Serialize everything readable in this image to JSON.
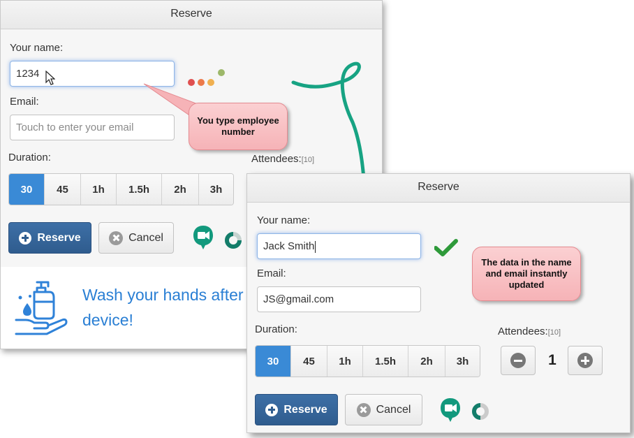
{
  "panel_back": {
    "title": "Reserve",
    "name_label": "Your name:",
    "name_value": "1234",
    "email_label": "Email:",
    "email_placeholder": "Touch to enter your email",
    "duration_label": "Duration:",
    "durations": [
      "30",
      "45",
      "1h",
      "1.5h",
      "2h",
      "3h"
    ],
    "attendees_label": "Attendees:",
    "attendees_max": "[10]",
    "reserve_label": "Reserve",
    "cancel_label": "Cancel",
    "notice_line1": "Wash your hands after",
    "notice_line2": "device!"
  },
  "panel_front": {
    "title": "Reserve",
    "name_label": "Your name:",
    "name_value": "Jack Smith",
    "email_label": "Email:",
    "email_value": "JS@gmail.com",
    "duration_label": "Duration:",
    "durations": [
      "30",
      "45",
      "1h",
      "1.5h",
      "2h",
      "3h"
    ],
    "attendees_label": "Attendees:",
    "attendees_max": "[10]",
    "attendees_count": "1",
    "reserve_label": "Reserve",
    "cancel_label": "Cancel"
  },
  "callouts": {
    "type_employee": "You type employee number",
    "data_updated": "The data in the name and email instantly updated"
  },
  "colors": {
    "accent": "#3a8ad6",
    "reserve_button": "#2f5c8e",
    "callout": "#f6b3b7",
    "arrow": "#17a383",
    "check": "#2e9a3a"
  },
  "icons": [
    "cursor-icon",
    "loading-dots-icon",
    "plus-circle-icon",
    "cancel-circle-icon",
    "meet-icon",
    "progress-ring-icon",
    "checkmark-icon",
    "minus-circle-icon",
    "hand-wash-icon"
  ]
}
